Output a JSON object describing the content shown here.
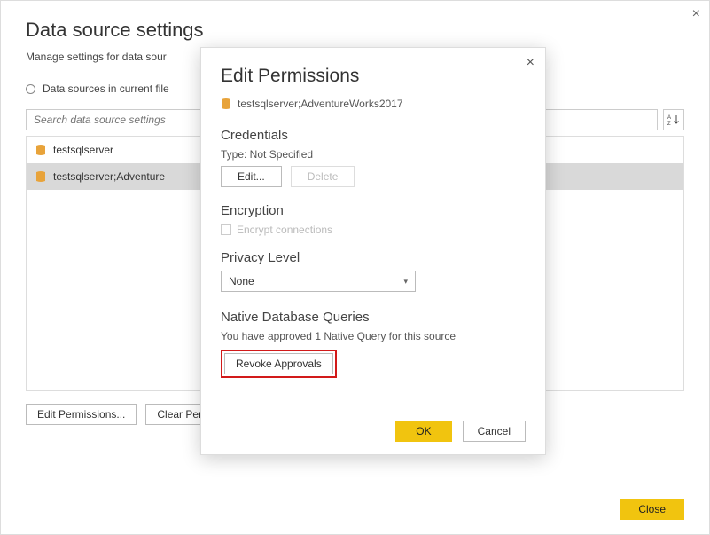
{
  "page": {
    "title": "Data source settings",
    "subtitle": "Manage settings for data sour",
    "radio_label": "Data sources in current file",
    "search_placeholder": "Search data source settings",
    "sort_label": "A↓Z"
  },
  "ds_list": {
    "items": [
      {
        "label": "testsqlserver"
      },
      {
        "label": "testsqlserver;Adventure"
      }
    ]
  },
  "bottom": {
    "edit_perms": "Edit Permissions...",
    "clear_perms": "Clear Perm",
    "close": "Close"
  },
  "modal": {
    "title": "Edit Permissions",
    "entity": "testsqlserver;AdventureWorks2017",
    "credentials_h": "Credentials",
    "type_line": "Type: Not Specified",
    "edit_btn": "Edit...",
    "delete_btn": "Delete",
    "encryption_h": "Encryption",
    "encrypt_label": "Encrypt connections",
    "privacy_h": "Privacy Level",
    "privacy_value": "None",
    "ndq_h": "Native Database Queries",
    "ndq_note": "You have approved 1 Native Query for this source",
    "revoke_btn": "Revoke Approvals",
    "ok": "OK",
    "cancel": "Cancel"
  }
}
